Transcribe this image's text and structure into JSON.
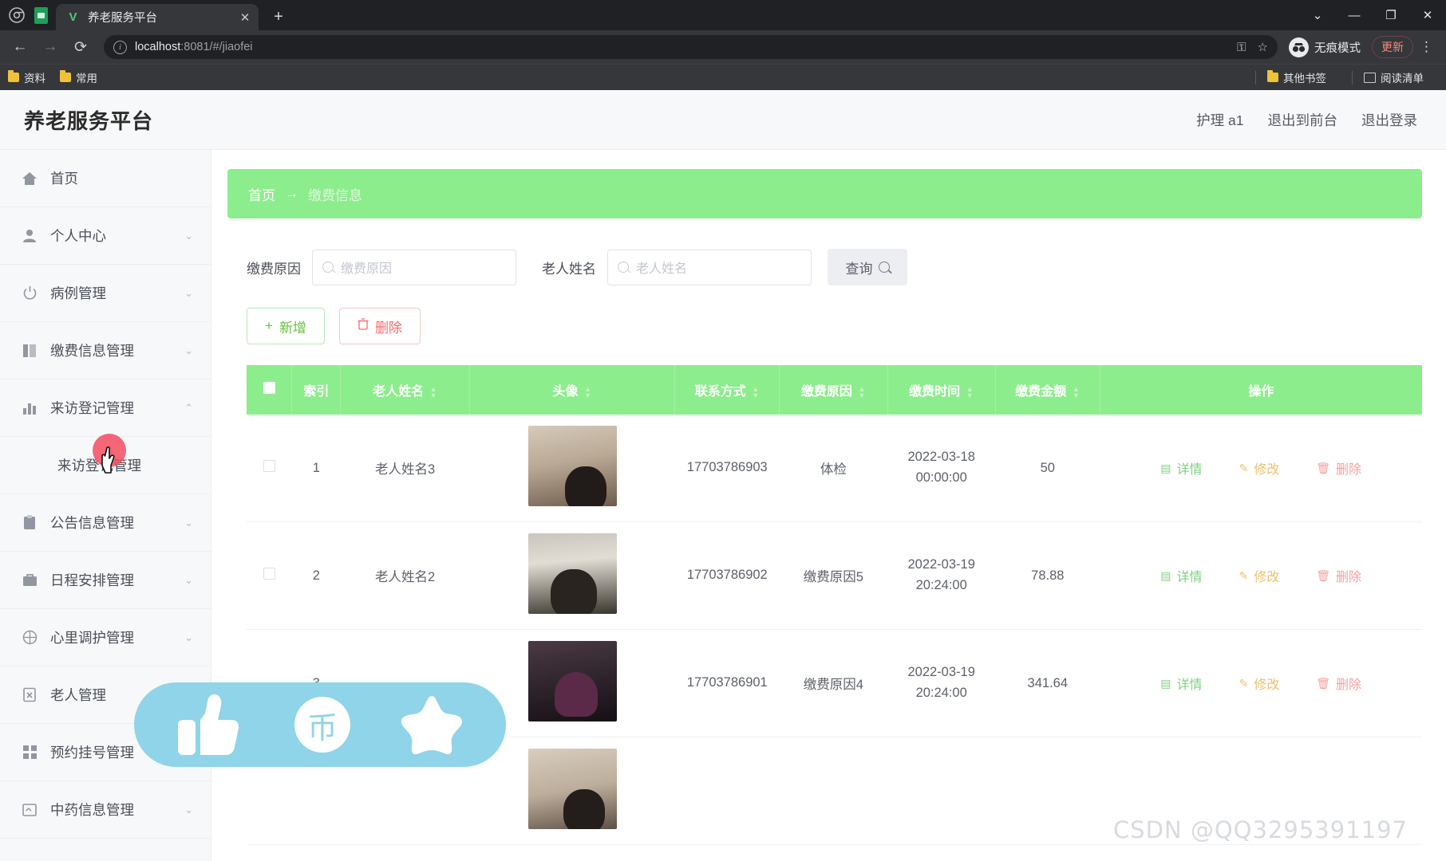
{
  "browser": {
    "tab_title": "养老服务平台",
    "tab_close": "✕",
    "new_tab": "+",
    "back": "←",
    "forward": "→",
    "reload": "⟳",
    "url_host": "localhost",
    "url_rest": ":8081/#/jiaofei",
    "key_icon": "key-icon",
    "star_icon": "☆",
    "incognito_label": "无痕模式",
    "update_label": "更新",
    "kebab": "⋮",
    "window_dropdown": "⌄",
    "window_minimize": "—",
    "window_maximize": "❐",
    "window_close": "✕",
    "bookmarks": [
      "资料",
      "常用"
    ],
    "other_bookmarks": "其他书签",
    "reading_list": "阅读清单"
  },
  "app": {
    "title": "养老服务平台",
    "header_links": [
      "护理 a1",
      "退出到前台",
      "退出登录"
    ]
  },
  "sidebar": {
    "items": [
      {
        "label": "首页",
        "icon": "home-icon",
        "caret": "",
        "sub": false
      },
      {
        "label": "个人中心",
        "icon": "user-icon",
        "caret": "⌄",
        "sub": false
      },
      {
        "label": "病例管理",
        "icon": "power-icon",
        "caret": "⌄",
        "sub": false
      },
      {
        "label": "缴费信息管理",
        "icon": "book-icon",
        "caret": "⌄",
        "sub": false
      },
      {
        "label": "来访登记管理",
        "icon": "bar-chart-icon",
        "caret": "⌃",
        "sub": false
      },
      {
        "label": "来访登记管理",
        "icon": "",
        "caret": "",
        "sub": true
      },
      {
        "label": "公告信息管理",
        "icon": "clipboard-icon",
        "caret": "⌄",
        "sub": false
      },
      {
        "label": "日程安排管理",
        "icon": "briefcase-icon",
        "caret": "⌄",
        "sub": false
      },
      {
        "label": "心里调护管理",
        "icon": "compass-icon",
        "caret": "⌄",
        "sub": false
      },
      {
        "label": "老人管理",
        "icon": "id-card-icon",
        "caret": "",
        "sub": false
      },
      {
        "label": "预约挂号管理",
        "icon": "grid-icon",
        "caret": "",
        "sub": false
      },
      {
        "label": "中药信息管理",
        "icon": "note-icon",
        "caret": "⌄",
        "sub": false
      }
    ]
  },
  "breadcrumb": {
    "home": "首页",
    "arrow": "→",
    "current": "缴费信息"
  },
  "search": {
    "label_reason": "缴费原因",
    "placeholder_reason": "缴费原因",
    "label_name": "老人姓名",
    "placeholder_name": "老人姓名",
    "value_reason": "",
    "value_name": "",
    "query_button": "查询"
  },
  "toolbar": {
    "add_label": "新增",
    "add_icon": "+",
    "delete_label": "删除",
    "delete_icon": "🗑"
  },
  "table": {
    "columns": [
      {
        "label": "",
        "sortable": false,
        "key": "checkbox"
      },
      {
        "label": "索引",
        "sortable": false,
        "key": "index"
      },
      {
        "label": "老人姓名",
        "sortable": true,
        "key": "name"
      },
      {
        "label": "头像",
        "sortable": true,
        "key": "avatar"
      },
      {
        "label": "联系方式",
        "sortable": true,
        "key": "phone"
      },
      {
        "label": "缴费原因",
        "sortable": true,
        "key": "reason"
      },
      {
        "label": "缴费时间",
        "sortable": true,
        "key": "time"
      },
      {
        "label": "缴费金额",
        "sortable": true,
        "key": "amount"
      },
      {
        "label": "操作",
        "sortable": false,
        "key": "ops"
      }
    ],
    "rows": [
      {
        "index": "1",
        "name": "老人姓名3",
        "avatar": "elder-photo-1",
        "phone": "17703786903",
        "reason": "体检",
        "time": "2022-03-18 00:00:00",
        "amount": "50"
      },
      {
        "index": "2",
        "name": "老人姓名2",
        "avatar": "elder-photo-2",
        "phone": "17703786902",
        "reason": "缴费原因5",
        "time": "2022-03-19 20:24:00",
        "amount": "78.88"
      },
      {
        "index": "3",
        "name": "",
        "avatar": "elder-photo-3",
        "phone": "17703786901",
        "reason": "缴费原因4",
        "time": "2022-03-19 20:24:00",
        "amount": "341.64"
      },
      {
        "index": "",
        "name": "",
        "avatar": "elder-photo-4",
        "phone": "",
        "reason": "",
        "time": "",
        "amount": ""
      }
    ],
    "ops": {
      "detail": "详情",
      "edit": "修改",
      "delete": "删除"
    }
  },
  "floatbar": {
    "like": "thumbs-up-icon",
    "coin": "币",
    "star": "star-icon"
  },
  "watermark": "CSDN @QQ3295391197",
  "colors": {
    "accent_green": "#8ced8c",
    "danger_red": "#f56c6c",
    "success_green": "#67c23a",
    "warn_orange": "#f0c070",
    "floatbar_blue": "#8fd4e8"
  }
}
